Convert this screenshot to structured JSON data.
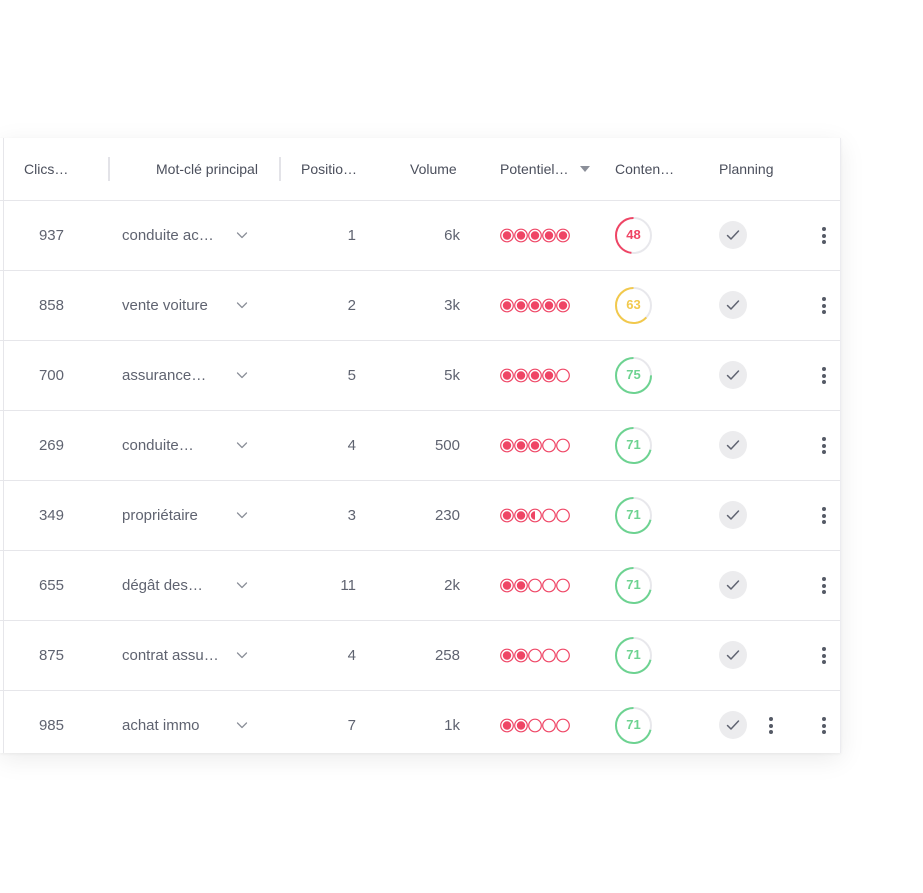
{
  "columns": {
    "clics": "Clics…",
    "keyword": "Mot-clé principal",
    "position": "Positio…",
    "volume": "Volume",
    "potentiel": "Potentiel…",
    "content": "Conten…",
    "planning": "Planning"
  },
  "colors": {
    "potential_red": "#ef4565",
    "score_red": "#ef4565",
    "score_yellow": "#f2c94c",
    "score_green": "#6dd391",
    "track": "#e8e8ec"
  },
  "rows": [
    {
      "clics": "937",
      "keyword": "conduite ac…",
      "position": "1",
      "volume": "6k",
      "potential": 5,
      "score": "48",
      "score_value": 48,
      "score_color": "red",
      "extra_menu": false
    },
    {
      "clics": "858",
      "keyword": "vente voiture",
      "position": "2",
      "volume": "3k",
      "potential": 5,
      "score": "63",
      "score_value": 63,
      "score_color": "yellow",
      "extra_menu": false
    },
    {
      "clics": "700",
      "keyword": "assurance…",
      "position": "5",
      "volume": "5k",
      "potential": 4,
      "score": "75",
      "score_value": 75,
      "score_color": "green",
      "extra_menu": false
    },
    {
      "clics": "269",
      "keyword": "conduite…",
      "position": "4",
      "volume": "500",
      "potential": 3,
      "score": "71",
      "score_value": 71,
      "score_color": "green",
      "extra_menu": false
    },
    {
      "clics": "349",
      "keyword": "propriétaire",
      "position": "3",
      "volume": "230",
      "potential": 2.5,
      "score": "71",
      "score_value": 71,
      "score_color": "green",
      "extra_menu": false
    },
    {
      "clics": "655",
      "keyword": "dégât des…",
      "position": "11",
      "volume": "2k",
      "potential": 2,
      "score": "71",
      "score_value": 71,
      "score_color": "green",
      "extra_menu": false
    },
    {
      "clics": "875",
      "keyword": "contrat assu…",
      "position": "4",
      "volume": "258",
      "potential": 2,
      "score": "71",
      "score_value": 71,
      "score_color": "green",
      "extra_menu": false
    },
    {
      "clics": "985",
      "keyword": "achat immo",
      "position": "7",
      "volume": "1k",
      "potential": 2,
      "score": "71",
      "score_value": 71,
      "score_color": "green",
      "extra_menu": true
    }
  ]
}
